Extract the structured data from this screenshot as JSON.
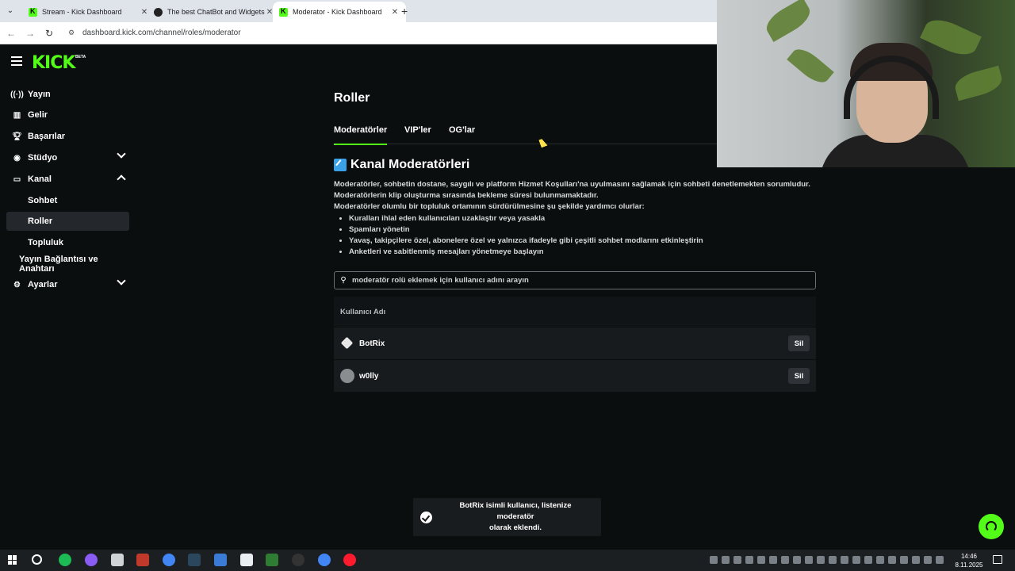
{
  "browser": {
    "tabs": [
      {
        "title": "Stream - Kick Dashboard",
        "favicon": "kick-icon",
        "active": false
      },
      {
        "title": "The best ChatBot and Widgets",
        "favicon": "github-icon",
        "active": false
      },
      {
        "title": "Moderator - Kick Dashboard",
        "favicon": "kick-icon",
        "active": true
      }
    ],
    "new_tab": "+",
    "url": "dashboard.kick.com/channel/roles/moderator"
  },
  "app": {
    "logo": "KICK",
    "logo_badge": "BETA",
    "accent": "#53fc18"
  },
  "sidebar": {
    "items": [
      {
        "label": "Yayın",
        "icon": "broadcast-icon"
      },
      {
        "label": "Gelir",
        "icon": "chart-icon"
      },
      {
        "label": "Başarılar",
        "icon": "trophy-icon"
      },
      {
        "label": "Stüdyo",
        "icon": "camera-icon",
        "chevron": "down"
      },
      {
        "label": "Kanal",
        "icon": "tv-icon",
        "chevron": "up"
      },
      {
        "label": "Sohbet",
        "sub": true
      },
      {
        "label": "Roller",
        "sub": true,
        "active": true
      },
      {
        "label": "Topluluk",
        "sub": true
      },
      {
        "label": "Yayın Bağlantısı ve Anahtarı",
        "sub": true
      },
      {
        "label": "Ayarlar",
        "icon": "gear-icon",
        "chevron": "down"
      }
    ]
  },
  "main": {
    "title": "Roller",
    "tabs": [
      "Moderatörler",
      "VIP'ler",
      "OG'lar"
    ],
    "active_tab": "Moderatörler",
    "section_title": "Kanal Moderatörleri",
    "description": [
      "Moderatörler, sohbetin dostane, saygılı ve platform Hizmet Koşulları'na uyulmasını sağlamak için sohbeti denetlemekten sorumludur.",
      "Moderatörlerin klip oluşturma sırasında bekleme süresi bulunmamaktadır.",
      "Moderatörler olumlu bir topluluk ortamının sürdürülmesine şu şekilde yardımcı olurlar:"
    ],
    "bullets": [
      "Kuralları ihlal eden kullanıcıları uzaklaştır veya yasakla",
      "Spamları yönetin",
      "Yavaş, takipçilere özel, abonelere özel ve yalnızca ifadeyle gibi çeşitli sohbet modlarını etkinleştirin",
      "Anketleri ve sabitlenmiş mesajları yönetmeye başlayın"
    ],
    "search_placeholder": "moderatör rolü eklemek için kullanıcı adını arayın",
    "table": {
      "header": "Kullanıcı Adı",
      "rows": [
        {
          "username": "BotRix",
          "action": "Sil"
        },
        {
          "username": "w0lly",
          "action": "Sil"
        }
      ]
    }
  },
  "toast": {
    "message_line1": "BotRix isimli kullanıcı, listenize moderatör",
    "message_line2": "olarak eklendi."
  },
  "taskbar": {
    "time": "14:46",
    "date": "8.11.2025"
  }
}
